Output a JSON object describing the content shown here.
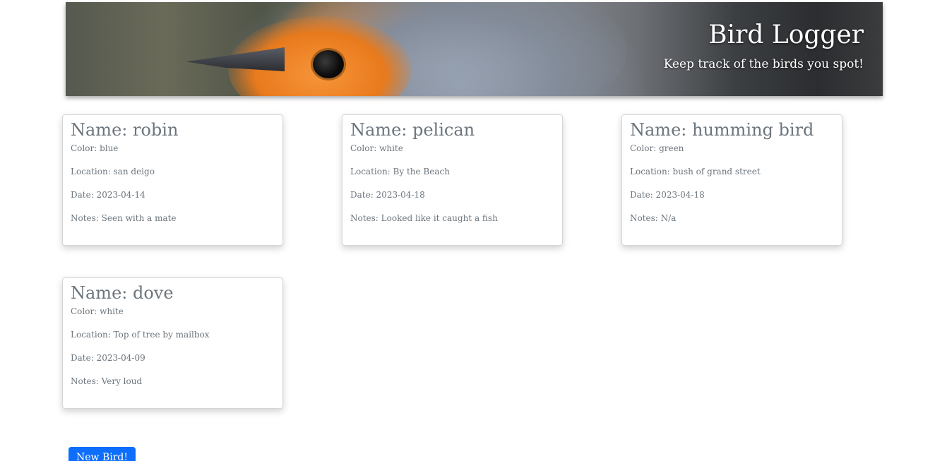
{
  "header": {
    "title": "Bird Logger",
    "subtitle": "Keep track of the birds you spot!"
  },
  "birds": [
    {
      "name": "Name: robin",
      "color": "Color: blue",
      "location": "Location: san deigo",
      "date": "Date: 2023-04-14",
      "notes": "Notes: Seen with a mate"
    },
    {
      "name": "Name: pelican",
      "color": "Color: white",
      "location": "Location: By the Beach",
      "date": "Date: 2023-04-18",
      "notes": "Notes: Looked like it caught a fish"
    },
    {
      "name": "Name: humming bird",
      "color": "Color: green",
      "location": "Location: bush of grand street",
      "date": "Date: 2023-04-18",
      "notes": "Notes: N/a"
    },
    {
      "name": "Name: dove",
      "color": "Color: white",
      "location": "Location: Top of tree by mailbox",
      "date": "Date: 2023-04-09",
      "notes": "Notes: Very loud"
    }
  ],
  "actions": {
    "new_bird_label": "New Bird!"
  },
  "theme": {
    "primary": "#0d6efd",
    "text_muted": "#6c757d"
  }
}
